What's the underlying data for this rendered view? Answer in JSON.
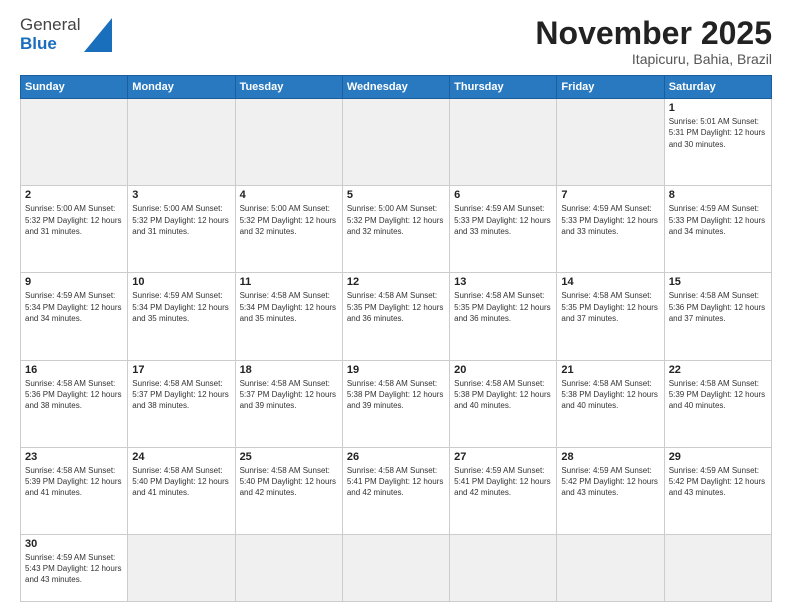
{
  "logo": {
    "line1": "General",
    "line2": "Blue"
  },
  "header": {
    "month": "November 2025",
    "location": "Itapicuru, Bahia, Brazil"
  },
  "weekdays": [
    "Sunday",
    "Monday",
    "Tuesday",
    "Wednesday",
    "Thursday",
    "Friday",
    "Saturday"
  ],
  "days": [
    {
      "num": "",
      "info": "",
      "empty": true
    },
    {
      "num": "",
      "info": "",
      "empty": true
    },
    {
      "num": "",
      "info": "",
      "empty": true
    },
    {
      "num": "",
      "info": "",
      "empty": true
    },
    {
      "num": "",
      "info": "",
      "empty": true
    },
    {
      "num": "",
      "info": "",
      "empty": true
    },
    {
      "num": "1",
      "info": "Sunrise: 5:01 AM\nSunset: 5:31 PM\nDaylight: 12 hours\nand 30 minutes."
    },
    {
      "num": "2",
      "info": "Sunrise: 5:00 AM\nSunset: 5:32 PM\nDaylight: 12 hours\nand 31 minutes."
    },
    {
      "num": "3",
      "info": "Sunrise: 5:00 AM\nSunset: 5:32 PM\nDaylight: 12 hours\nand 31 minutes."
    },
    {
      "num": "4",
      "info": "Sunrise: 5:00 AM\nSunset: 5:32 PM\nDaylight: 12 hours\nand 32 minutes."
    },
    {
      "num": "5",
      "info": "Sunrise: 5:00 AM\nSunset: 5:32 PM\nDaylight: 12 hours\nand 32 minutes."
    },
    {
      "num": "6",
      "info": "Sunrise: 4:59 AM\nSunset: 5:33 PM\nDaylight: 12 hours\nand 33 minutes."
    },
    {
      "num": "7",
      "info": "Sunrise: 4:59 AM\nSunset: 5:33 PM\nDaylight: 12 hours\nand 33 minutes."
    },
    {
      "num": "8",
      "info": "Sunrise: 4:59 AM\nSunset: 5:33 PM\nDaylight: 12 hours\nand 34 minutes."
    },
    {
      "num": "9",
      "info": "Sunrise: 4:59 AM\nSunset: 5:34 PM\nDaylight: 12 hours\nand 34 minutes."
    },
    {
      "num": "10",
      "info": "Sunrise: 4:59 AM\nSunset: 5:34 PM\nDaylight: 12 hours\nand 35 minutes."
    },
    {
      "num": "11",
      "info": "Sunrise: 4:58 AM\nSunset: 5:34 PM\nDaylight: 12 hours\nand 35 minutes."
    },
    {
      "num": "12",
      "info": "Sunrise: 4:58 AM\nSunset: 5:35 PM\nDaylight: 12 hours\nand 36 minutes."
    },
    {
      "num": "13",
      "info": "Sunrise: 4:58 AM\nSunset: 5:35 PM\nDaylight: 12 hours\nand 36 minutes."
    },
    {
      "num": "14",
      "info": "Sunrise: 4:58 AM\nSunset: 5:35 PM\nDaylight: 12 hours\nand 37 minutes."
    },
    {
      "num": "15",
      "info": "Sunrise: 4:58 AM\nSunset: 5:36 PM\nDaylight: 12 hours\nand 37 minutes."
    },
    {
      "num": "16",
      "info": "Sunrise: 4:58 AM\nSunset: 5:36 PM\nDaylight: 12 hours\nand 38 minutes."
    },
    {
      "num": "17",
      "info": "Sunrise: 4:58 AM\nSunset: 5:37 PM\nDaylight: 12 hours\nand 38 minutes."
    },
    {
      "num": "18",
      "info": "Sunrise: 4:58 AM\nSunset: 5:37 PM\nDaylight: 12 hours\nand 39 minutes."
    },
    {
      "num": "19",
      "info": "Sunrise: 4:58 AM\nSunset: 5:38 PM\nDaylight: 12 hours\nand 39 minutes."
    },
    {
      "num": "20",
      "info": "Sunrise: 4:58 AM\nSunset: 5:38 PM\nDaylight: 12 hours\nand 40 minutes."
    },
    {
      "num": "21",
      "info": "Sunrise: 4:58 AM\nSunset: 5:38 PM\nDaylight: 12 hours\nand 40 minutes."
    },
    {
      "num": "22",
      "info": "Sunrise: 4:58 AM\nSunset: 5:39 PM\nDaylight: 12 hours\nand 40 minutes."
    },
    {
      "num": "23",
      "info": "Sunrise: 4:58 AM\nSunset: 5:39 PM\nDaylight: 12 hours\nand 41 minutes."
    },
    {
      "num": "24",
      "info": "Sunrise: 4:58 AM\nSunset: 5:40 PM\nDaylight: 12 hours\nand 41 minutes."
    },
    {
      "num": "25",
      "info": "Sunrise: 4:58 AM\nSunset: 5:40 PM\nDaylight: 12 hours\nand 42 minutes."
    },
    {
      "num": "26",
      "info": "Sunrise: 4:58 AM\nSunset: 5:41 PM\nDaylight: 12 hours\nand 42 minutes."
    },
    {
      "num": "27",
      "info": "Sunrise: 4:59 AM\nSunset: 5:41 PM\nDaylight: 12 hours\nand 42 minutes."
    },
    {
      "num": "28",
      "info": "Sunrise: 4:59 AM\nSunset: 5:42 PM\nDaylight: 12 hours\nand 43 minutes."
    },
    {
      "num": "29",
      "info": "Sunrise: 4:59 AM\nSunset: 5:42 PM\nDaylight: 12 hours\nand 43 minutes."
    },
    {
      "num": "30",
      "info": "Sunrise: 4:59 AM\nSunset: 5:43 PM\nDaylight: 12 hours\nand 43 minutes."
    },
    {
      "num": "",
      "info": "",
      "empty": true
    },
    {
      "num": "",
      "info": "",
      "empty": true
    },
    {
      "num": "",
      "info": "",
      "empty": true
    },
    {
      "num": "",
      "info": "",
      "empty": true
    },
    {
      "num": "",
      "info": "",
      "empty": true
    }
  ]
}
